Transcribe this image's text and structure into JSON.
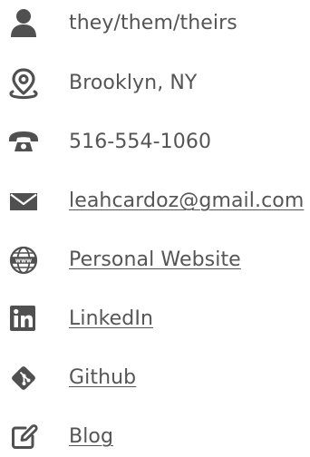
{
  "colors": {
    "icon": "#505050",
    "text": "#555555"
  },
  "contact": {
    "pronouns": {
      "icon": "person-icon",
      "text": "they/them/theirs"
    },
    "location": {
      "icon": "map-pin-icon",
      "text": "Brooklyn, NY"
    },
    "phone": {
      "icon": "telephone-icon",
      "text": "516-554-1060"
    },
    "email": {
      "icon": "envelope-icon",
      "text": "leahcardoz@gmail.com"
    },
    "website": {
      "icon": "globe-www-icon",
      "text": "Personal Website"
    },
    "linkedin": {
      "icon": "linkedin-icon",
      "text": "LinkedIn"
    },
    "github": {
      "icon": "git-icon",
      "text": "Github"
    },
    "blog": {
      "icon": "edit-icon",
      "text": "Blog"
    }
  }
}
